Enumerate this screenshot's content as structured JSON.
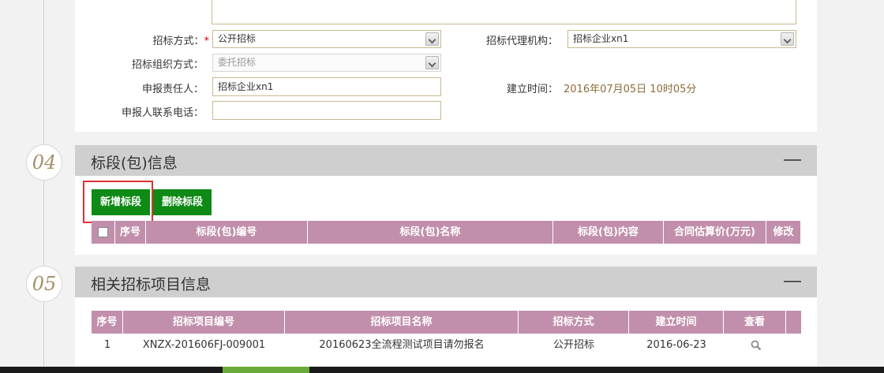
{
  "section3": {
    "fields": [
      {
        "label": "招标方式：",
        "required": "*",
        "value": "公开招标"
      },
      {
        "label": "招标代理机构：",
        "value": "招标企业xn1"
      },
      {
        "label": "招标组织方式：",
        "value": "委托招标"
      },
      {
        "label": "申报责任人：",
        "value": "招标企业xn1"
      },
      {
        "label": "建立时间：",
        "value": "2016年07月05日 10时05分"
      },
      {
        "label": "申报人联系电话：",
        "value": ""
      }
    ]
  },
  "section4": {
    "number": "04",
    "title": "标段(包)信息",
    "buttons": {
      "add": "新增标段",
      "delete": "删除标段"
    },
    "columns": [
      "序号",
      "标段(包)编号",
      "标段(包)名称",
      "标段(包)内容",
      "合同估算价(万元)",
      "修改"
    ]
  },
  "section5": {
    "number": "05",
    "title": "相关招标项目信息",
    "columns": [
      "序号",
      "招标项目编号",
      "招标项目名称",
      "招标方式",
      "建立时间",
      "查看"
    ],
    "rows": [
      {
        "no": "1",
        "code": "XNZX-201606FJ-009001",
        "name": "20160623全流程测试项目请勿报名",
        "method": "公开招标",
        "date": "2016-06-23",
        "view_icon": "magnifier-icon"
      }
    ]
  },
  "colors": {
    "header": "#c18fab",
    "button": "#0e8a16",
    "highlight": "#e03030",
    "accent_text": "#a88f6b"
  }
}
